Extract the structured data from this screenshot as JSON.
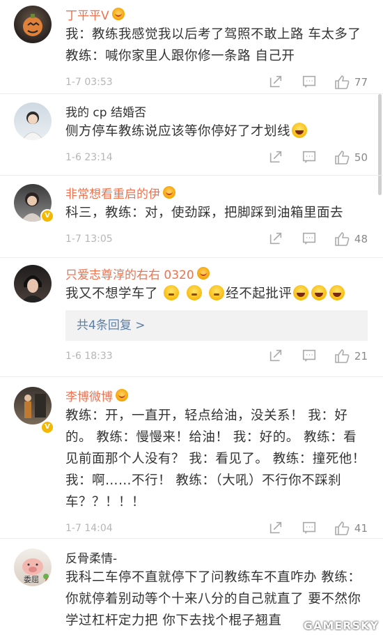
{
  "comments": [
    {
      "name": "丁平平V",
      "text": "我：教练我感觉我以后考了驾照不敢上路 车太多了 教练：喊你家里人跟你修一条路 自己开",
      "time": "1-7 03:53",
      "likes": "77"
    },
    {
      "name": "我的 cp 结婚否",
      "text": "侧方停车教练说应该等你停好了才划线",
      "time": "1-6 23:14",
      "likes": "50"
    },
    {
      "name": "非常想看重启的伊",
      "text": "科三，教练：对，使劲踩，把脚踩到油箱里面去",
      "time": "1-7 13:05",
      "likes": "48"
    },
    {
      "name": "只爱志尊淳的右右 0320",
      "text_prefix": "我又不想学车了",
      "text_suffix": "经不起批评",
      "replies": "共4条回复 >",
      "time": "1-6 18:33",
      "likes": "21"
    },
    {
      "name": "李博微博",
      "text": "教练：开，一直开，轻点给油，没关系！ 我：好的。 教练：慢慢来！给油！ 我：好的。 教练：看见前面那个人没有？ 我：看见了。 教练：撞死他！ 我：啊……不行！ 教练：（大吼）不行你不踩刹车？？！！！",
      "time": "1-7 14:04",
      "likes": "41"
    },
    {
      "name": "反骨柔情-",
      "avatar_label": "委屈",
      "text": "我科二车停不直就停下了问教练车不直咋办 教练：你就停着别动等个十来八分的自己就直了 要不然你学过杠杆定力把 你下去找个棍子翘直"
    }
  ],
  "watermark": "GAMERSKY",
  "colors": {
    "vip_name": "#eb7350",
    "reply_link": "#5c7fa8",
    "meta": "#b5b5b5"
  },
  "icons": [
    "share-icon",
    "comment-icon",
    "like-icon",
    "crown-badge-icon",
    "v-verified-icon"
  ]
}
